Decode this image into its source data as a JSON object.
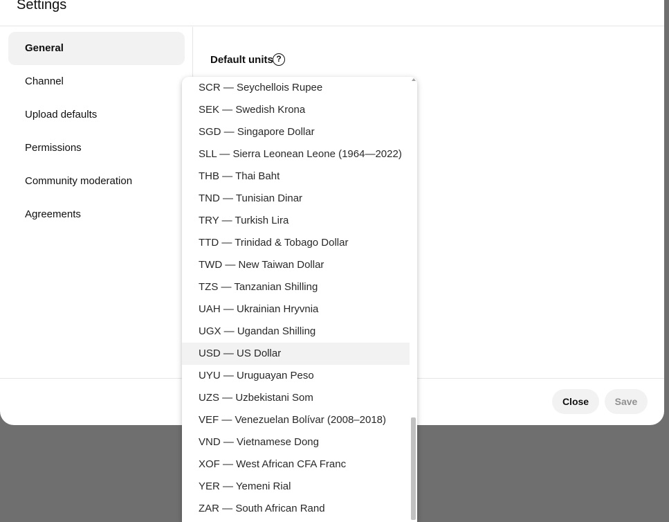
{
  "dialog": {
    "title": "Settings",
    "nav": [
      {
        "label": "General",
        "active": true
      },
      {
        "label": "Channel",
        "active": false
      },
      {
        "label": "Upload defaults",
        "active": false
      },
      {
        "label": "Permissions",
        "active": false
      },
      {
        "label": "Community moderation",
        "active": false
      },
      {
        "label": "Agreements",
        "active": false
      }
    ],
    "section_label": "Default units",
    "help_icon": "?",
    "close_label": "Close",
    "save_label": "Save"
  },
  "currency_dropdown": {
    "selected": "USD — US Dollar",
    "options": [
      "SCR — Seychellois Rupee",
      "SEK — Swedish Krona",
      "SGD — Singapore Dollar",
      "SLL — Sierra Leonean Leone (1964—2022)",
      "THB — Thai Baht",
      "TND — Tunisian Dinar",
      "TRY — Turkish Lira",
      "TTD — Trinidad & Tobago Dollar",
      "TWD — New Taiwan Dollar",
      "TZS — Tanzanian Shilling",
      "UAH — Ukrainian Hryvnia",
      "UGX — Ugandan Shilling",
      "USD — US Dollar",
      "UYU — Uruguayan Peso",
      "UZS — Uzbekistani Som",
      "VEF — Venezuelan Bolívar (2008–2018)",
      "VND — Vietnamese Dong",
      "XOF — West African CFA Franc",
      "YER — Yemeni Rial",
      "ZAR — South African Rand"
    ]
  }
}
